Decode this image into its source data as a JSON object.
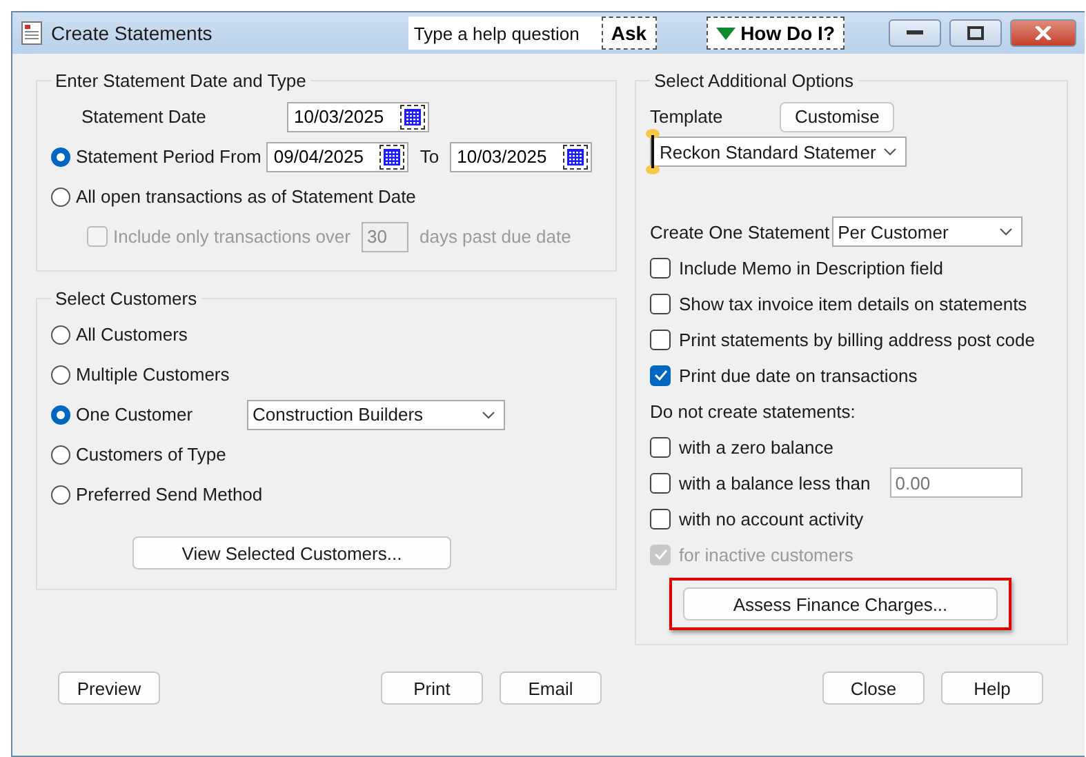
{
  "window": {
    "title": "Create Statements",
    "help_search": {
      "placeholder": "Type a help question"
    },
    "ask_button": "Ask",
    "how_do_i_button": "How Do I?"
  },
  "date_section": {
    "title": "Enter Statement Date and Type",
    "statement_date": {
      "label": "Statement Date",
      "value": "10/03/2025"
    },
    "options": [
      {
        "kind": "period",
        "label": "Statement Period From",
        "selected": true,
        "from": "09/04/2025",
        "to_label": "To",
        "to": "10/03/2025"
      },
      {
        "kind": "plain",
        "label": "All open transactions as of Statement Date",
        "selected": false
      }
    ],
    "overdue_filter": {
      "label": "Include only transactions over",
      "value": "30",
      "suffix": "days past due date",
      "checked": false,
      "disabled": true
    }
  },
  "customers": {
    "title": "Select Customers",
    "options": [
      {
        "label": "All Customers",
        "selected": false
      },
      {
        "label": "Multiple Customers",
        "selected": false
      },
      {
        "label": "One Customer",
        "selected": true,
        "dropdown": "Construction Builders"
      },
      {
        "label": "Customers of Type",
        "selected": false
      },
      {
        "label": "Preferred Send Method",
        "selected": false
      }
    ],
    "view_button": "View Selected Customers..."
  },
  "options": {
    "title": "Select Additional Options",
    "template_label": "Template",
    "customise_button": "Customise",
    "template_value": "Reckon Standard Statemer",
    "create_one_label": "Create One Statement",
    "create_one_value": "Per Customer",
    "checkboxes": [
      {
        "label": "Include Memo in Description field",
        "checked": false
      },
      {
        "label": "Show tax invoice item details on statements",
        "checked": false
      },
      {
        "label": "Print statements by billing address post code",
        "checked": false
      },
      {
        "label": "Print due date on transactions",
        "checked": true
      }
    ],
    "do_not_label": "Do not create statements:",
    "exclusions": [
      {
        "label": "with a zero balance",
        "checked": false,
        "disabled": false
      },
      {
        "label": "with a balance less than",
        "checked": false,
        "disabled": false,
        "placeholder": "0.00"
      },
      {
        "label": "with no account activity",
        "checked": false,
        "disabled": false
      },
      {
        "label": "for inactive customers",
        "checked": true,
        "disabled": true
      }
    ],
    "finance_button": {
      "label": "Assess Finance Charges...",
      "highlighted": true
    }
  },
  "footer": {
    "left": [
      "Preview"
    ],
    "middle": [
      "Print",
      "Email"
    ],
    "right": [
      "Close",
      "Help"
    ]
  }
}
